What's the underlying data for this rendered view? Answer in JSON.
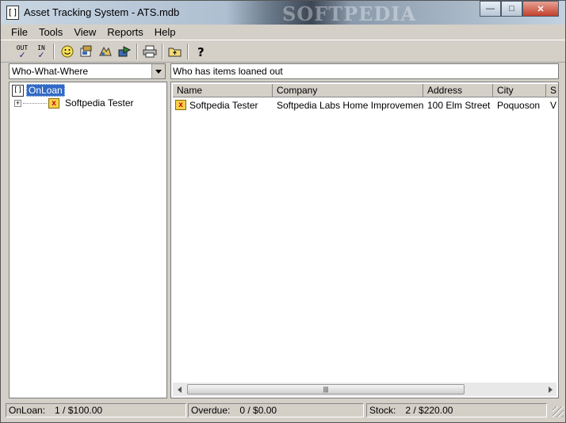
{
  "window": {
    "title": "Asset Tracking System - ATS.mdb",
    "watermark": "SOFTPEDIA",
    "minimize_glyph": "—",
    "maximize_glyph": "□",
    "close_glyph": "✕"
  },
  "menu": [
    "File",
    "Tools",
    "View",
    "Reports",
    "Help"
  ],
  "toolbar": {
    "out_label": "OUT",
    "in_label": "IN",
    "check_glyph": "✓"
  },
  "view_select": {
    "value": "Who-What-Where"
  },
  "tree": {
    "root_label": "OnLoan",
    "root_icon_glyph": "[]",
    "children": [
      {
        "label": "Softpedia Tester",
        "expander": "+"
      }
    ]
  },
  "list": {
    "caption": "Who has items loaned out",
    "columns": [
      "Name",
      "Company",
      "Address",
      "City",
      "S"
    ],
    "rows": [
      {
        "name": "Softpedia Tester",
        "company": "Softpedia Labs Home Improvements",
        "address": "100 Elm Street",
        "city": "Poquoson",
        "state": "V"
      }
    ],
    "scroll_thumb_glyph": "|||"
  },
  "status": {
    "onloan_label": "OnLoan:",
    "onloan_value": "1 / $100.00",
    "overdue_label": "Overdue:",
    "overdue_value": "0 / $0.00",
    "stock_label": "Stock:",
    "stock_value": "2 / $220.00"
  }
}
